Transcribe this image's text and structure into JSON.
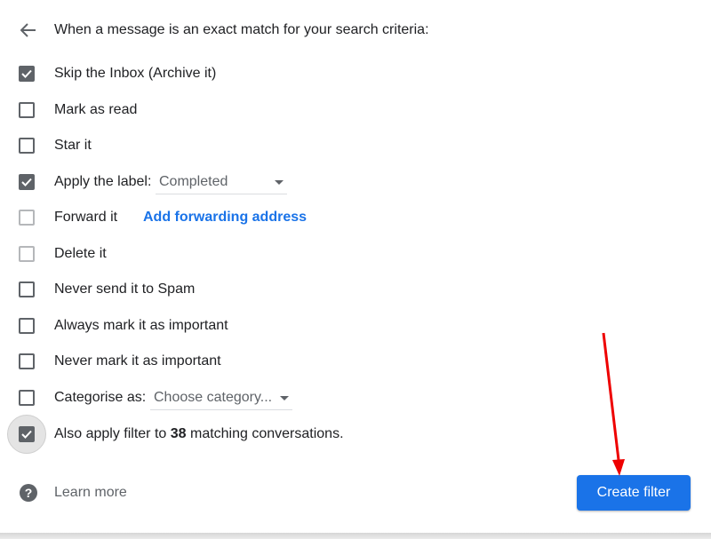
{
  "header": {
    "back_icon": "arrow-left-icon",
    "text": "When a message is an exact match for your search criteria:"
  },
  "options": [
    {
      "label": "Skip the Inbox (Archive it)",
      "checked": true,
      "enabled": true
    },
    {
      "label": "Mark as read",
      "checked": false,
      "enabled": true
    },
    {
      "label": "Star it",
      "checked": false,
      "enabled": true
    },
    {
      "label": "Apply the label:",
      "checked": true,
      "enabled": true,
      "select_value": "Completed"
    },
    {
      "label": "Forward it",
      "checked": false,
      "enabled": false,
      "link": "Add forwarding address"
    },
    {
      "label": "Delete it",
      "checked": false,
      "enabled": false
    },
    {
      "label": "Never send it to Spam",
      "checked": false,
      "enabled": true
    },
    {
      "label": "Always mark it as important",
      "checked": false,
      "enabled": true
    },
    {
      "label": "Never mark it as important",
      "checked": false,
      "enabled": true
    },
    {
      "label": "Categorise as:",
      "checked": false,
      "enabled": true,
      "select_value": "Choose category..."
    },
    {
      "label_prefix": "Also apply filter to",
      "count": "38",
      "label_suffix": "matching conversations.",
      "checked": true,
      "enabled": true,
      "focused": true
    }
  ],
  "footer": {
    "help_icon": "help-circle-icon",
    "learn_more": "Learn more",
    "create_filter": "Create filter"
  },
  "annotation": {
    "type": "red-arrow",
    "color": "#ee0000"
  },
  "colors": {
    "primary": "#1a73e8",
    "checkbox": "#5f6368"
  }
}
